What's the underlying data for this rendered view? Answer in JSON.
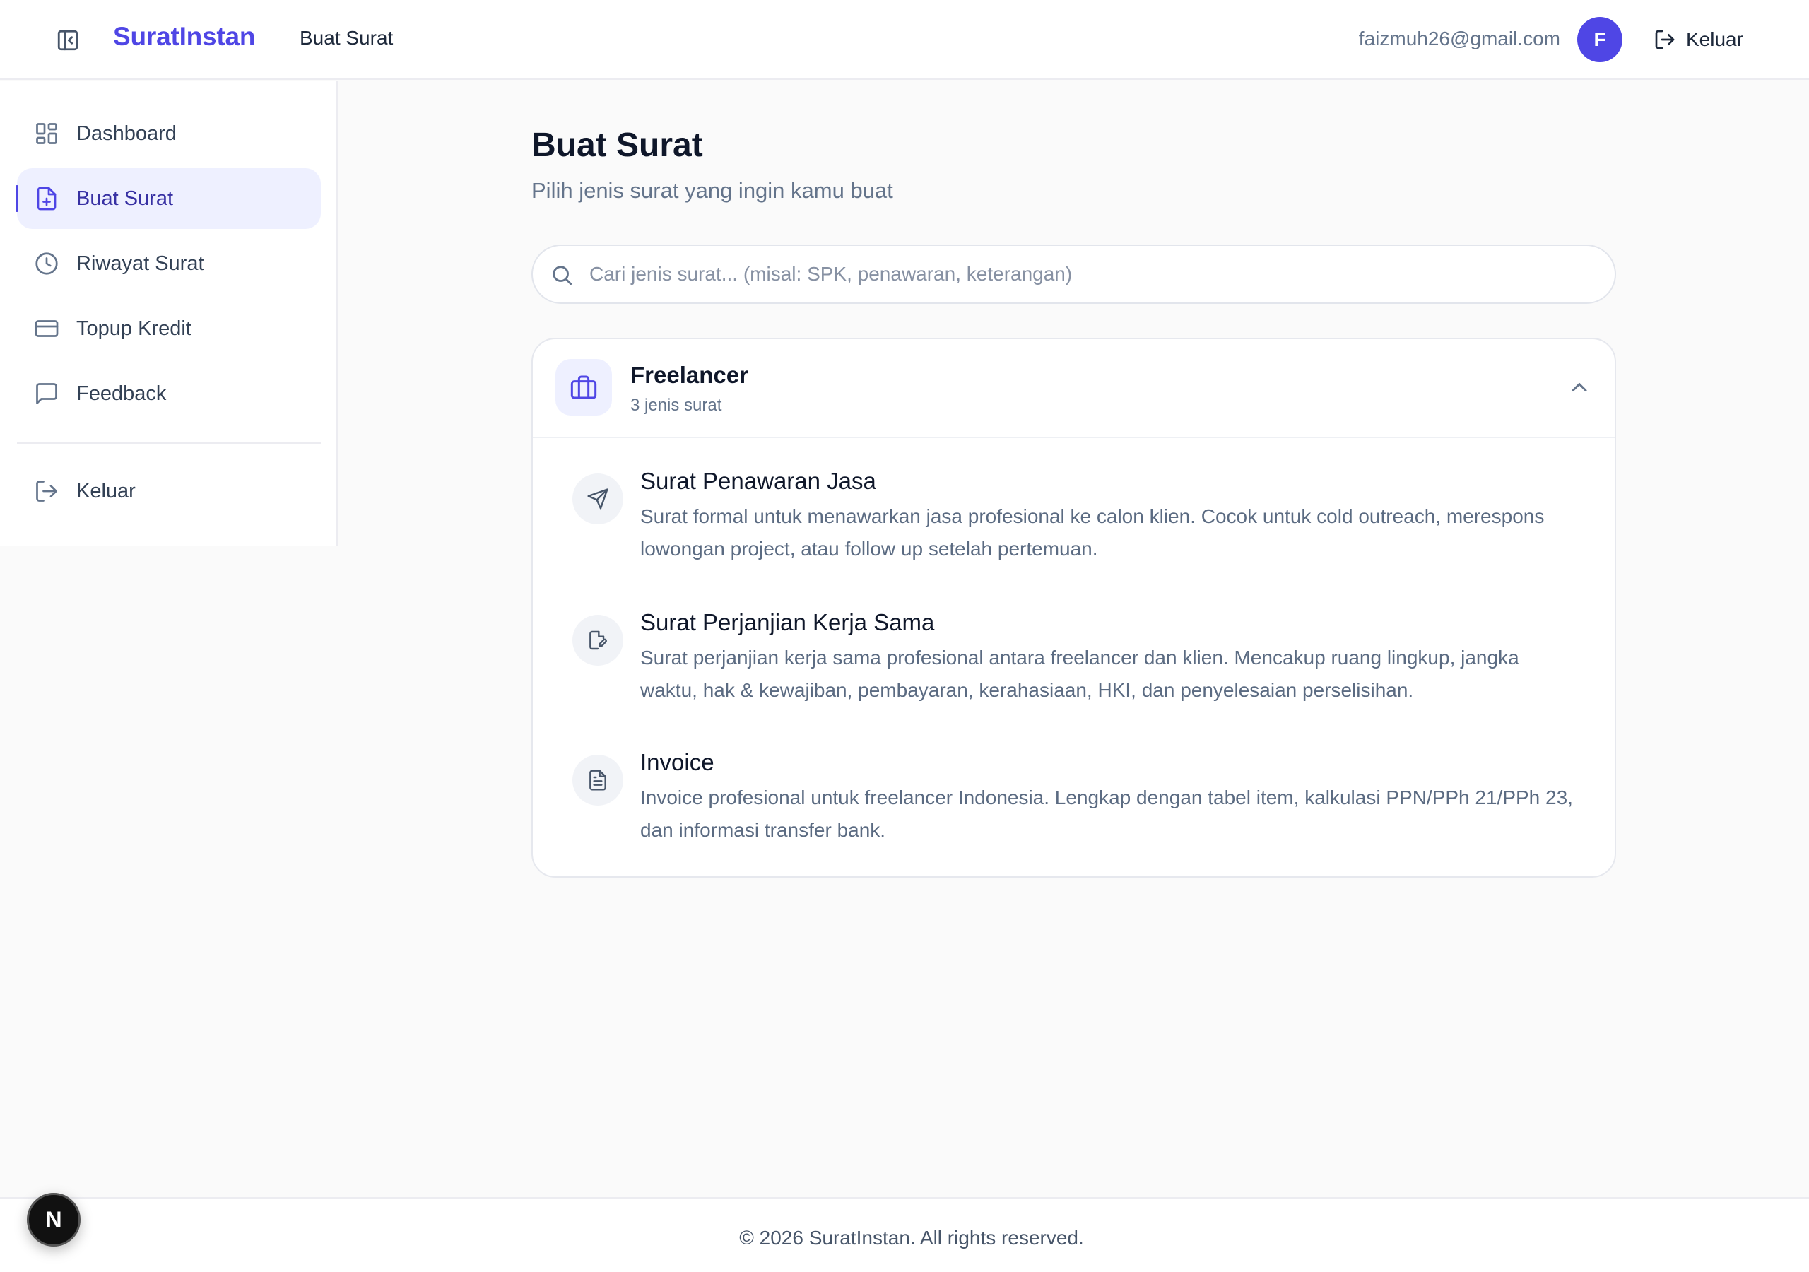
{
  "header": {
    "brand": "SuratInstan",
    "page": "Buat Surat",
    "email": "faizmuh26@gmail.com",
    "avatar_initial": "F",
    "logout_label": "Keluar"
  },
  "sidebar": {
    "items": [
      {
        "label": "Dashboard",
        "icon": "dashboard-icon"
      },
      {
        "label": "Buat Surat",
        "icon": "file-plus-icon",
        "active": true
      },
      {
        "label": "Riwayat Surat",
        "icon": "clock-icon"
      },
      {
        "label": "Topup Kredit",
        "icon": "credit-card-icon"
      },
      {
        "label": "Feedback",
        "icon": "message-square-icon"
      }
    ],
    "logout_label": "Keluar"
  },
  "main": {
    "title": "Buat Surat",
    "subtitle": "Pilih jenis surat yang ingin kamu buat",
    "search_placeholder": "Cari jenis surat... (misal: SPK, penawaran, keterangan)",
    "category": {
      "name": "Freelancer",
      "count": "3 jenis surat",
      "items": [
        {
          "title": "Surat Penawaran Jasa",
          "desc": "Surat formal untuk menawarkan jasa profesional ke calon klien. Cocok untuk cold outreach, merespons lowongan project, atau follow up setelah pertemuan."
        },
        {
          "title": "Surat Perjanjian Kerja Sama",
          "desc": "Surat perjanjian kerja sama profesional antara freelancer dan klien. Mencakup ruang lingkup, jangka waktu, hak & kewajiban, pembayaran, kerahasiaan, HKI, dan penyelesaian perselisihan."
        },
        {
          "title": "Invoice",
          "desc": "Invoice profesional untuk freelancer Indonesia. Lengkap dengan tabel item, kalkulasi PPN/PPh 21/PPh 23, dan informasi transfer bank."
        }
      ]
    }
  },
  "footer": {
    "text": "© 2026 SuratInstan. All rights reserved."
  },
  "dev_badge": "N",
  "colors": {
    "accent": "#4f46e5",
    "active_bg": "#eef0ff",
    "background": "#fafafa"
  }
}
